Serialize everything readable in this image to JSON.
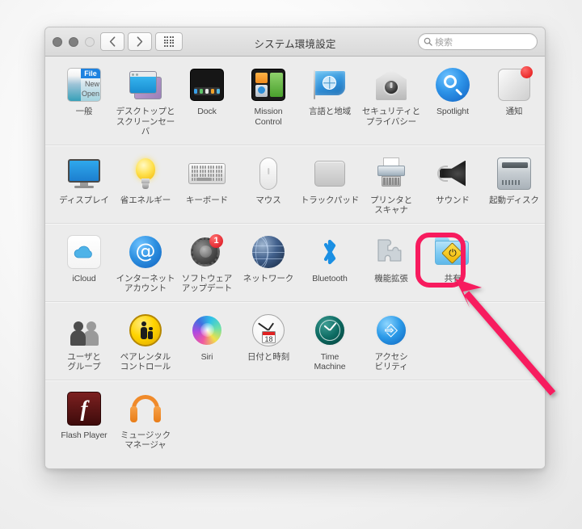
{
  "window": {
    "title": "システム環境設定",
    "traffic_lights": [
      "close",
      "minimize",
      "zoom"
    ],
    "nav": {
      "back_label": "‹",
      "forward_label": "›",
      "show_all_label": "show-all-grid"
    },
    "search": {
      "placeholder": "検索",
      "value": ""
    }
  },
  "rows": [
    {
      "items": [
        {
          "name": "general",
          "label": "一般",
          "icon": "general-icon",
          "icon_text": {
            "menu_title": "File",
            "item1": "New",
            "item2": "Open"
          }
        },
        {
          "name": "desktop-screensaver",
          "label": "デスクトップと\nスクリーンセーバ",
          "icon": "desktop-screensaver-icon"
        },
        {
          "name": "dock",
          "label": "Dock",
          "icon": "dock-icon"
        },
        {
          "name": "mission-control",
          "label": "Mission\nControl",
          "icon": "mission-control-icon"
        },
        {
          "name": "language-region",
          "label": "言語と地域",
          "icon": "language-region-flag-icon"
        },
        {
          "name": "security-privacy",
          "label": "セキュリティと\nプライバシー",
          "icon": "security-privacy-icon"
        },
        {
          "name": "spotlight",
          "label": "Spotlight",
          "icon": "spotlight-icon"
        },
        {
          "name": "notifications",
          "label": "通知",
          "icon": "notifications-icon",
          "badge_dot": true
        }
      ]
    },
    {
      "items": [
        {
          "name": "displays",
          "label": "ディスプレイ",
          "icon": "display-icon"
        },
        {
          "name": "energy-saver",
          "label": "省エネルギー",
          "icon": "lightbulb-icon"
        },
        {
          "name": "keyboard",
          "label": "キーボード",
          "icon": "keyboard-icon"
        },
        {
          "name": "mouse",
          "label": "マウス",
          "icon": "mouse-icon"
        },
        {
          "name": "trackpad",
          "label": "トラックパッド",
          "icon": "trackpad-icon"
        },
        {
          "name": "printers-scanners",
          "label": "プリンタと\nスキャナ",
          "icon": "printer-icon"
        },
        {
          "name": "sound",
          "label": "サウンド",
          "icon": "speaker-icon"
        },
        {
          "name": "startup-disk",
          "label": "起動ディスク",
          "icon": "hard-disk-icon"
        }
      ]
    },
    {
      "items": [
        {
          "name": "icloud",
          "label": "iCloud",
          "icon": "cloud-icon"
        },
        {
          "name": "internet-accounts",
          "label": "インターネット\nアカウント",
          "icon": "at-sign-icon",
          "icon_text": "@"
        },
        {
          "name": "software-update",
          "label": "ソフトウェア\nアップデート",
          "icon": "gear-icon",
          "badge_count": "1"
        },
        {
          "name": "network",
          "label": "ネットワーク",
          "icon": "globe-icon"
        },
        {
          "name": "bluetooth",
          "label": "Bluetooth",
          "icon": "bluetooth-icon"
        },
        {
          "name": "extensions",
          "label": "機能拡張",
          "icon": "puzzle-piece-icon"
        },
        {
          "name": "sharing",
          "label": "共有",
          "icon": "sharing-folder-icon",
          "highlighted": true
        }
      ]
    },
    {
      "items": [
        {
          "name": "users-groups",
          "label": "ユーザと\nグループ",
          "icon": "users-icon"
        },
        {
          "name": "parental-controls",
          "label": "ペアレンタル\nコントロール",
          "icon": "parental-controls-icon"
        },
        {
          "name": "siri",
          "label": "Siri",
          "icon": "siri-icon"
        },
        {
          "name": "date-time",
          "label": "日付と時刻",
          "icon": "clock-icon",
          "icon_text": "18"
        },
        {
          "name": "time-machine",
          "label": "Time\nMachine",
          "icon": "time-machine-icon"
        },
        {
          "name": "accessibility",
          "label": "アクセシ\nビリティ",
          "icon": "accessibility-icon"
        }
      ]
    },
    {
      "items": [
        {
          "name": "flash-player",
          "label": "Flash Player",
          "icon": "flash-player-icon",
          "icon_text": "f"
        },
        {
          "name": "music-manager",
          "label": "ミュージック\nマネージャ",
          "icon": "headphones-icon"
        }
      ]
    }
  ],
  "annotation": {
    "highlight_color": "#f71b5e",
    "target": "共有",
    "shapes": [
      "rounded-rect-highlight",
      "arrow-pointing-up-left"
    ]
  }
}
